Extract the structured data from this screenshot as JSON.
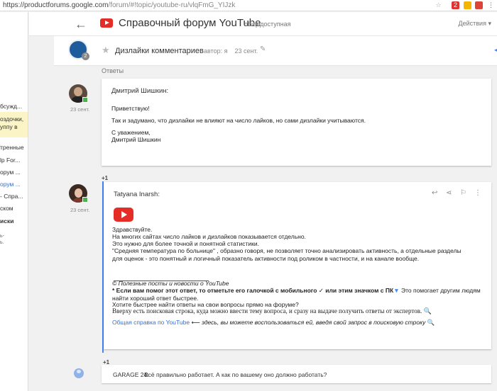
{
  "browser": {
    "url_main": "https://productforums.google.com",
    "url_rest": "/forum/#!topic/youtube-ru/vlqFmG_YIJzk",
    "ext_badge": "2"
  },
  "sidebar": {
    "items": [
      "бсужд...",
      "оздочки,",
      "уппу в",
      "тренные",
      "lp For...",
      "орум ...",
      "орум ...",
      "- Спра...",
      "ском",
      "иски",
      "ь-",
      "ь."
    ]
  },
  "header": {
    "back_icon": "arrow-left-icon",
    "title": "Справочный форум YouTube",
    "subtitle": "общедоступная",
    "actions_label": "Действия",
    "actions_caret": "▾"
  },
  "topic": {
    "title": "Дизлайки комментариев",
    "author": "автор: я",
    "date": "23 сент.",
    "avatar_count": "2",
    "replies_label": "Ответы"
  },
  "post1": {
    "author": "Дмитрий Шишкин:",
    "date": "23 сент.",
    "greeting": "Приветствую!",
    "body": "Так и задумано, что дизлайки не влияют на число лайков, но сами дизлайки учитываются.",
    "signoff": "С уважением,",
    "signature": "Дмитрий Шишкин",
    "plus": "+1"
  },
  "post2": {
    "author": "Tatyana Inarsh:",
    "date": "23 сент.",
    "hello": "Здравствуйте.",
    "line1": "На многих сайтах число лайков и дизлайков показывается отдельно.",
    "line2": "Это нужно для более точной и понятной статистики.",
    "line3": "\"Средняя температура по больнице\" , образно говоря,  не позволяет точно анализировать активность, а отдельные разделы для оценок - это понятный и логичный показатель активности под роликом в частности, и на канале вообще.",
    "useful": "© Полезные посты и новости о YouTube",
    "tip_bold": "* Если вам помог этот ответ, то отметьте его галочкой с мобильного  ✓ или этим значком с ПК",
    "tip_rest": " Это помогает другим людям найти хороший ответ быстрее.",
    "question": "Хотите быстрее найти ответы на свои вопросы прямо на форуме?",
    "serif_line": "Вверху есть поисковая строка, куда можно ввести тему вопроса, и сразу на выдаче  получить ответы от экспертов.",
    "help_link": "Общая справка по YouTube",
    "help_rest": " ⟵ здесь, вы можете воспользоваться ей, введя свой запрос в поисковую строку",
    "plus": "+1"
  },
  "post3": {
    "author": "GARAGE 24:",
    "text": "Всё правильно работает. А как по вашему оно должно работать?"
  }
}
